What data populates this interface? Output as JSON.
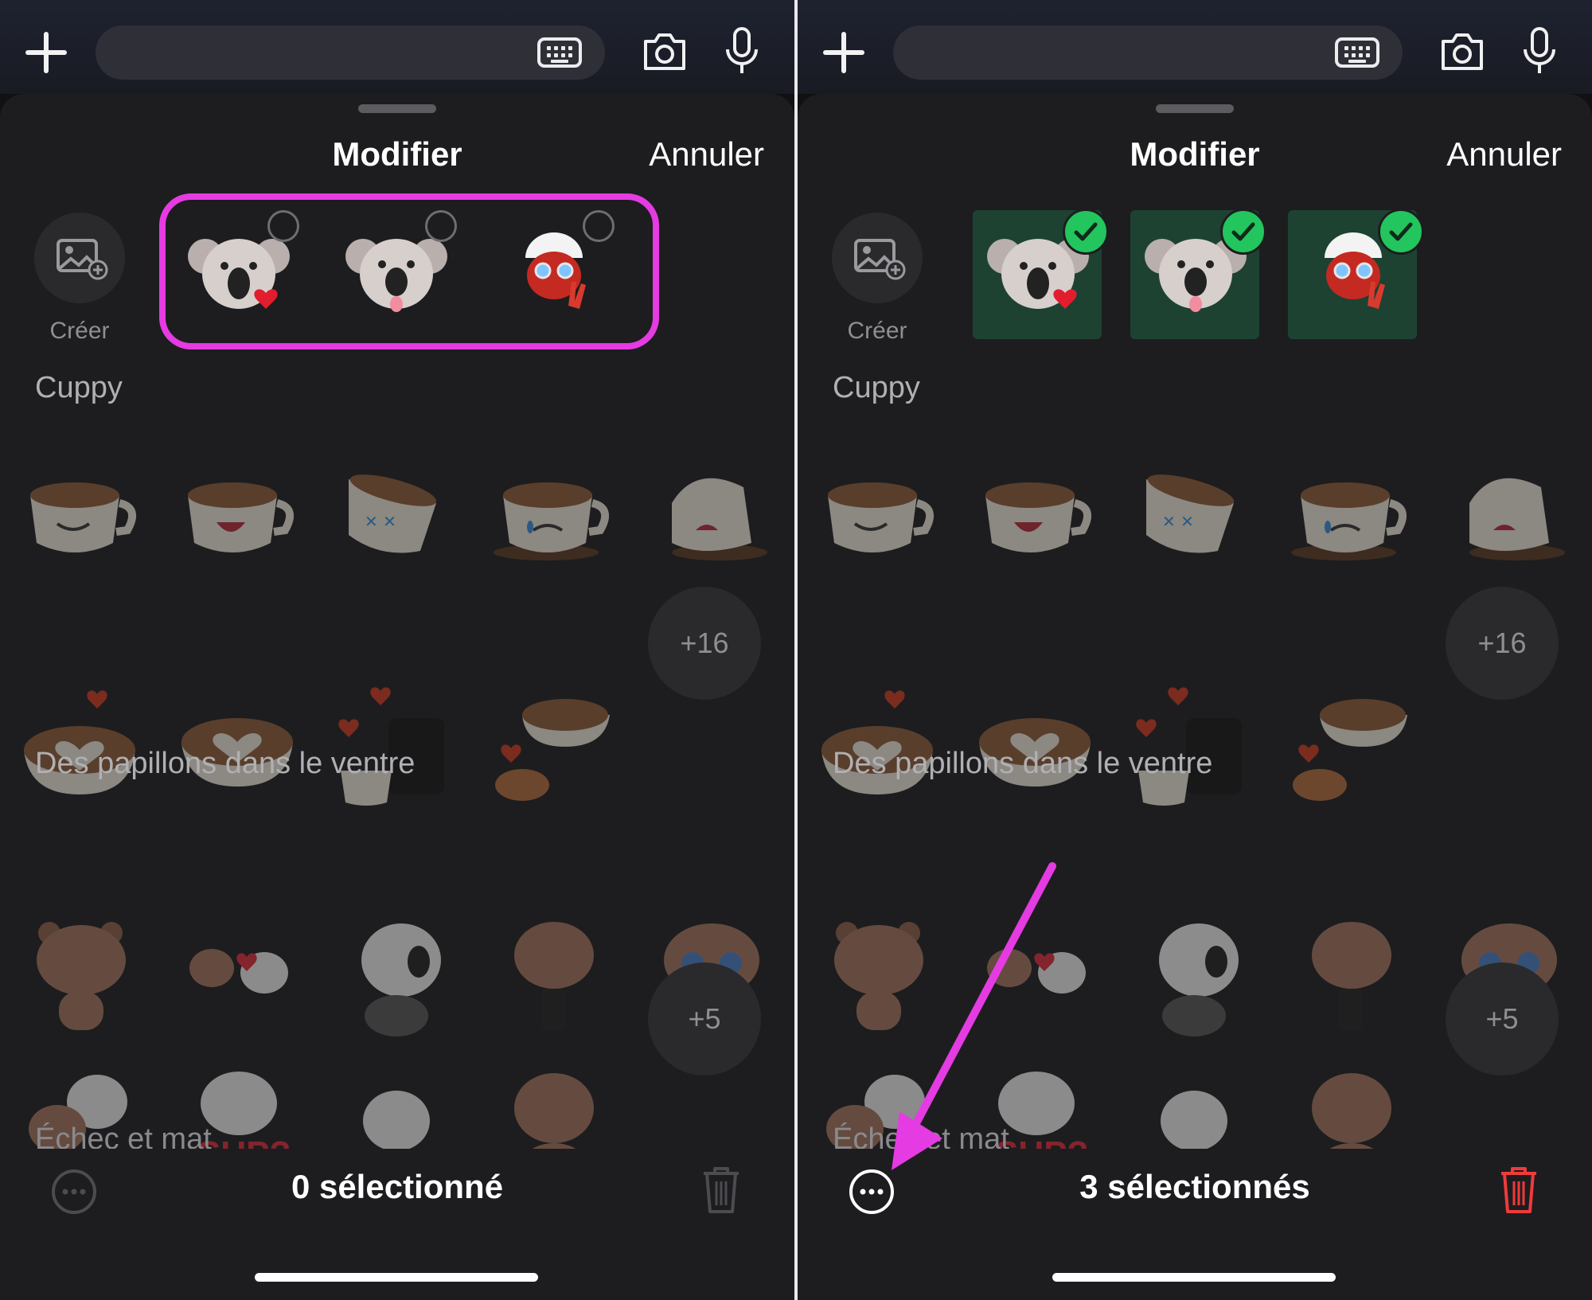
{
  "left": {
    "header": {
      "title": "Modifier",
      "cancel": "Annuler"
    },
    "create_label": "Créer",
    "sections": [
      "Cuppy",
      "Des papillons dans le ventre",
      "Échec et mat"
    ],
    "more_counts": [
      "+16",
      "+5"
    ],
    "selection_text": "0 sélectionné"
  },
  "right": {
    "header": {
      "title": "Modifier",
      "cancel": "Annuler"
    },
    "create_label": "Créer",
    "sections": [
      "Cuppy",
      "Des papillons dans le ventre",
      "Échec et mat"
    ],
    "more_counts": [
      "+16",
      "+5"
    ],
    "selection_text": "3 sélectionnés"
  },
  "colors": {
    "accent_green": "#22c55e",
    "delete_red": "#ef3b3b",
    "annotation_magenta": "#e53be2",
    "sheet_bg": "#1d1d1f"
  },
  "icons": [
    "plus-icon",
    "keyboard-icon",
    "camera-icon",
    "microphone-icon",
    "create-sticker-icon",
    "more-options-icon",
    "trash-icon",
    "checkmark-icon"
  ]
}
